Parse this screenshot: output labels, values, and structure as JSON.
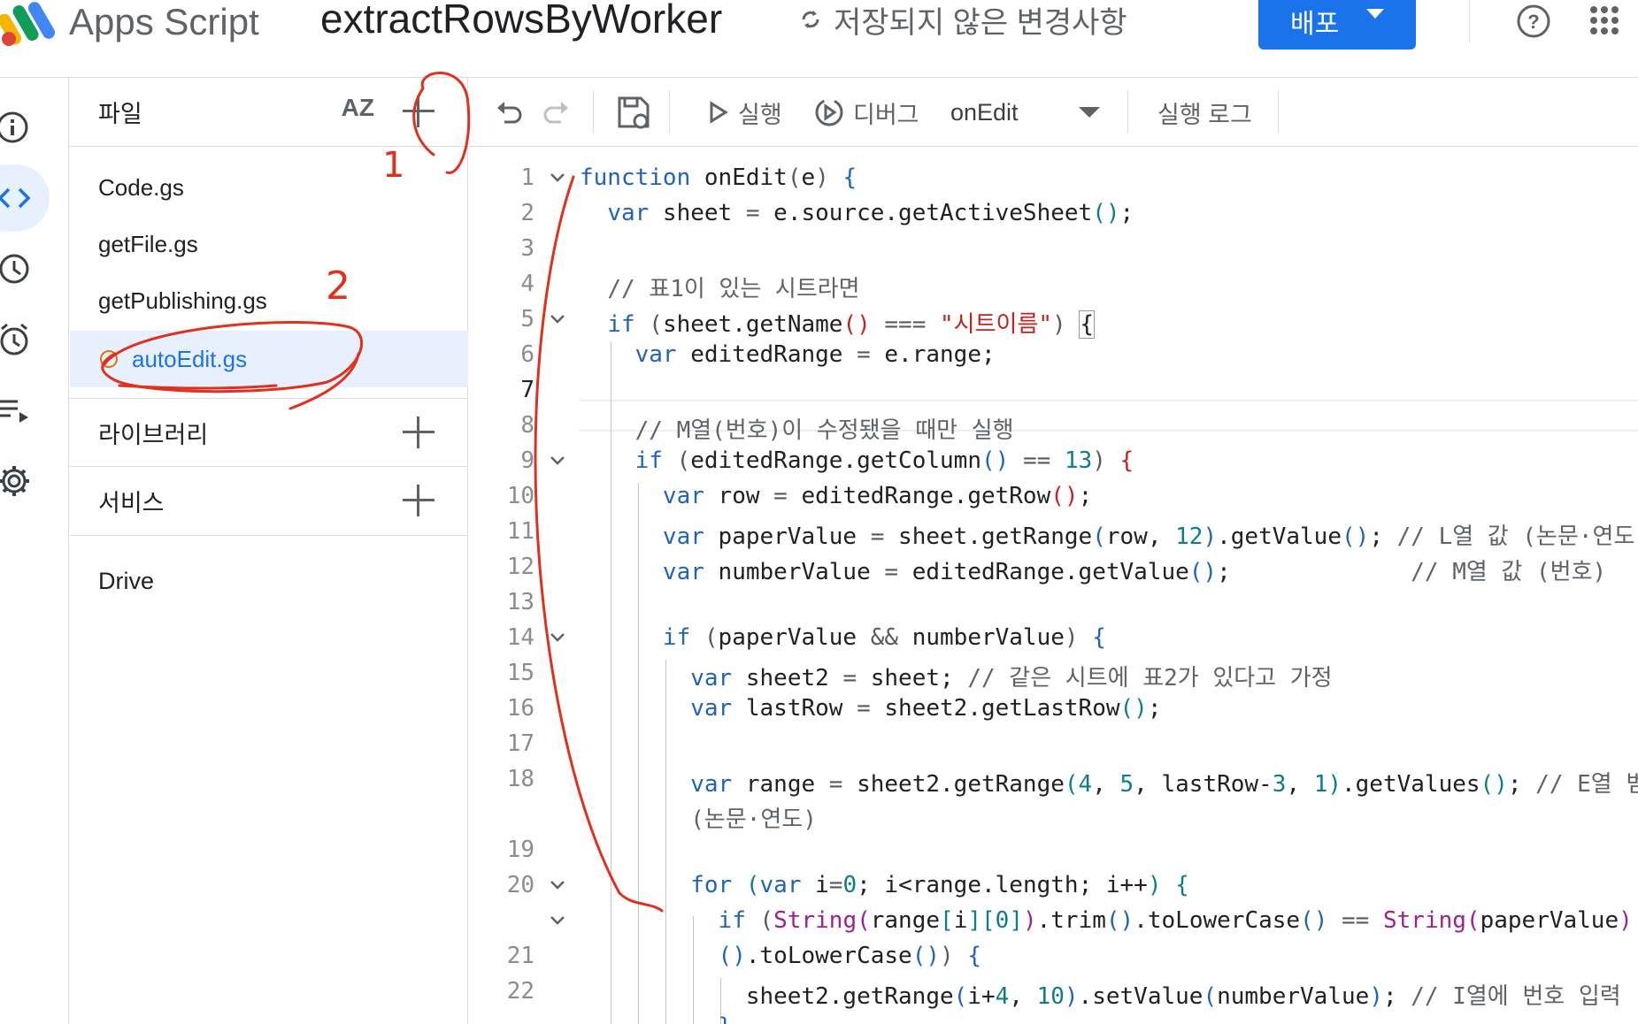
{
  "header": {
    "app_name": "Apps Script",
    "project_title": "extractRowsByWorker",
    "save_status": "저장되지 않은 변경사항",
    "deploy_label": "배포"
  },
  "rail": {
    "items": [
      {
        "name": "info-icon",
        "label": ""
      },
      {
        "name": "code-icon",
        "label": ""
      },
      {
        "name": "history-icon",
        "label": ""
      },
      {
        "name": "alarm-icon",
        "label": ""
      },
      {
        "name": "executions-icon",
        "label": ""
      },
      {
        "name": "settings-icon",
        "label": ""
      }
    ]
  },
  "files_panel": {
    "title": "파일",
    "files": [
      "Code.gs",
      "getFile.gs",
      "getPublishing.gs",
      "autoEdit.gs"
    ],
    "libraries_label": "라이브러리",
    "services_label": "서비스",
    "drive_label": "Drive"
  },
  "toolbar": {
    "run_label": "실행",
    "debug_label": "디버그",
    "function_select": "onEdit",
    "execution_log_label": "실행 로그"
  },
  "editor": {
    "line_numbers": [
      "1",
      "2",
      "3",
      "4",
      "5",
      "6",
      "7",
      "8",
      "9",
      "10",
      "11",
      "12",
      "13",
      "14",
      "15",
      "16",
      "17",
      "18",
      "19",
      "20",
      "21",
      "22"
    ],
    "current_line": "7"
  },
  "annotations": {
    "mark_1": "1",
    "mark_2": "2"
  },
  "colors": {
    "accent": "#1a73e8",
    "keyword": "#1f64b8",
    "number": "#0b7e86",
    "string": "#c5221f",
    "annotation_red": "#e0301e"
  }
}
